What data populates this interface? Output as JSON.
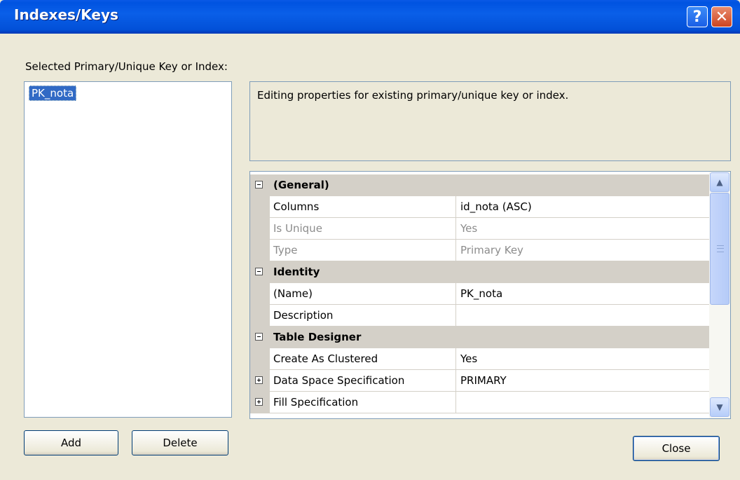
{
  "window": {
    "title": "Indexes/Keys",
    "help_glyph": "?",
    "close_glyph": "✕"
  },
  "left_panel": {
    "label": "Selected Primary/Unique Key or Index:",
    "items": [
      "PK_nota"
    ]
  },
  "description": {
    "text": "Editing properties for existing primary/unique key or index."
  },
  "property_grid": {
    "rows": [
      {
        "type": "category",
        "name": "(General)"
      },
      {
        "type": "property",
        "name": "Columns",
        "value": "id_nota (ASC)",
        "disabled": false
      },
      {
        "type": "property",
        "name": "Is Unique",
        "value": "Yes",
        "disabled": true
      },
      {
        "type": "property",
        "name": "Type",
        "value": "Primary Key",
        "disabled": true
      },
      {
        "type": "category",
        "name": "Identity"
      },
      {
        "type": "property",
        "name": "(Name)",
        "value": "PK_nota",
        "disabled": false
      },
      {
        "type": "property",
        "name": "Description",
        "value": "",
        "disabled": false
      },
      {
        "type": "category",
        "name": "Table Designer"
      },
      {
        "type": "property",
        "name": "Create As Clustered",
        "value": "Yes",
        "disabled": false
      },
      {
        "type": "property",
        "name": "Data Space Specification",
        "value": "PRIMARY",
        "disabled": false,
        "expandable": true
      },
      {
        "type": "property",
        "name": "Fill Specification",
        "value": "",
        "disabled": false,
        "expandable": true
      }
    ]
  },
  "buttons": {
    "add": "Add",
    "delete": "Delete",
    "close": "Close"
  },
  "colors": {
    "titlebar": "#0a5fe8",
    "selection": "#316ac5",
    "category_bg": "#d4d0c8",
    "window_bg": "#ece9d8"
  }
}
